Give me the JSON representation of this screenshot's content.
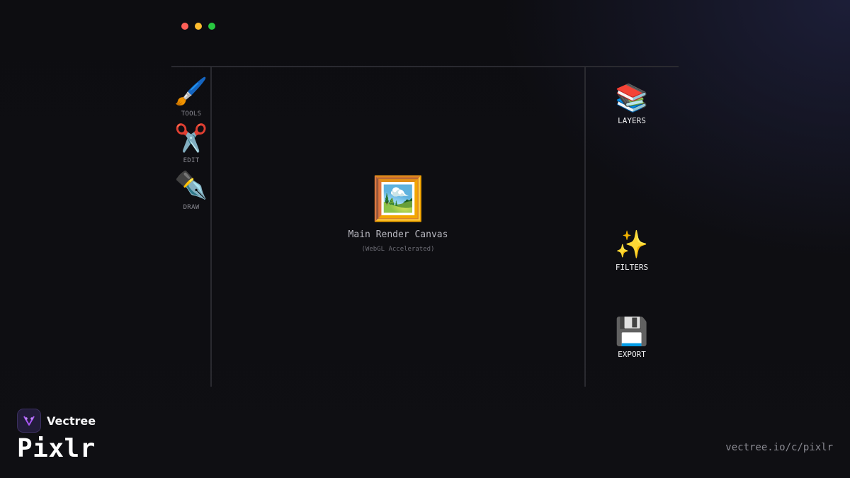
{
  "window": {
    "controls": [
      "close",
      "minimize",
      "maximize"
    ],
    "colors": {
      "close": "#ff5f57",
      "minimize": "#febc2e",
      "maximize": "#28c840"
    }
  },
  "left_toolbar": {
    "items": [
      {
        "icon": "paintbrush-icon",
        "glyph": "🖌️",
        "label": "TOOLS"
      },
      {
        "icon": "scissors-icon",
        "glyph": "✂️",
        "label": "EDIT"
      },
      {
        "icon": "pen-nib-icon",
        "glyph": "✒️",
        "label": "DRAW"
      }
    ]
  },
  "canvas": {
    "icon": "framed-picture-icon",
    "glyph": "🖼️",
    "title": "Main Render Canvas",
    "subtitle": "(WebGL Accelerated)"
  },
  "right_panel": {
    "items": [
      {
        "icon": "books-icon",
        "glyph": "📚",
        "label": "LAYERS"
      },
      {
        "icon": "sparkles-icon",
        "glyph": "✨",
        "label": "FILTERS"
      },
      {
        "icon": "floppy-disk-icon",
        "glyph": "💾",
        "label": "EXPORT"
      }
    ]
  },
  "brand": {
    "company": "Vectree",
    "product": "Pixlr",
    "accent": "#a855f7"
  },
  "footer": {
    "url": "vectree.io/c/pixlr"
  }
}
